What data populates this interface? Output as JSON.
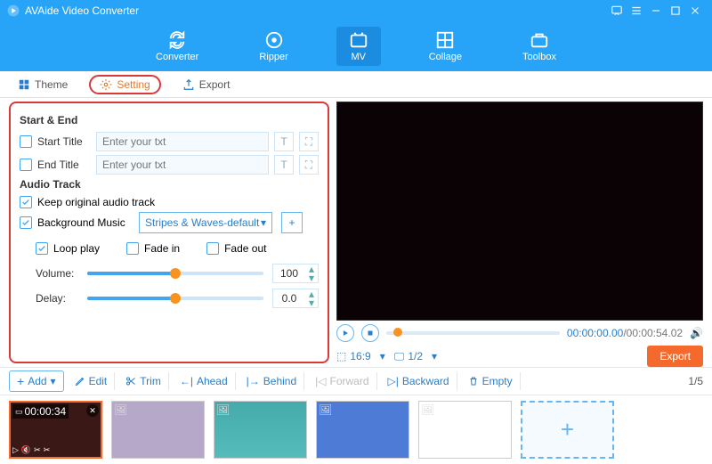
{
  "app": {
    "title": "AVAide Video Converter"
  },
  "toolbar": {
    "converter": "Converter",
    "ripper": "Ripper",
    "mv": "MV",
    "collage": "Collage",
    "toolbox": "Toolbox"
  },
  "tabs": {
    "theme": "Theme",
    "setting": "Setting",
    "export": "Export"
  },
  "startEnd": {
    "title": "Start & End",
    "startTitle": "Start Title",
    "endTitle": "End Title",
    "placeholder": "Enter your txt"
  },
  "audio": {
    "title": "Audio Track",
    "keepOriginal": "Keep original audio track",
    "bgMusic": "Background Music",
    "bgMusicValue": "Stripes & Waves-default",
    "loop": "Loop play",
    "fadeIn": "Fade in",
    "fadeOut": "Fade out",
    "volume": "Volume:",
    "volumeVal": "100",
    "delay": "Delay:",
    "delayVal": "0.0"
  },
  "preview": {
    "current": "00:00:00.00",
    "duration": "/00:00:54.02",
    "aspect": "16:9",
    "screen": "1/2",
    "export": "Export"
  },
  "btnbar": {
    "add": "Add",
    "edit": "Edit",
    "trim": "Trim",
    "ahead": "Ahead",
    "behind": "Behind",
    "forward": "Forward",
    "backward": "Backward",
    "empty": "Empty",
    "page": "1/5"
  },
  "thumbs": {
    "t1": "00:00:34"
  }
}
